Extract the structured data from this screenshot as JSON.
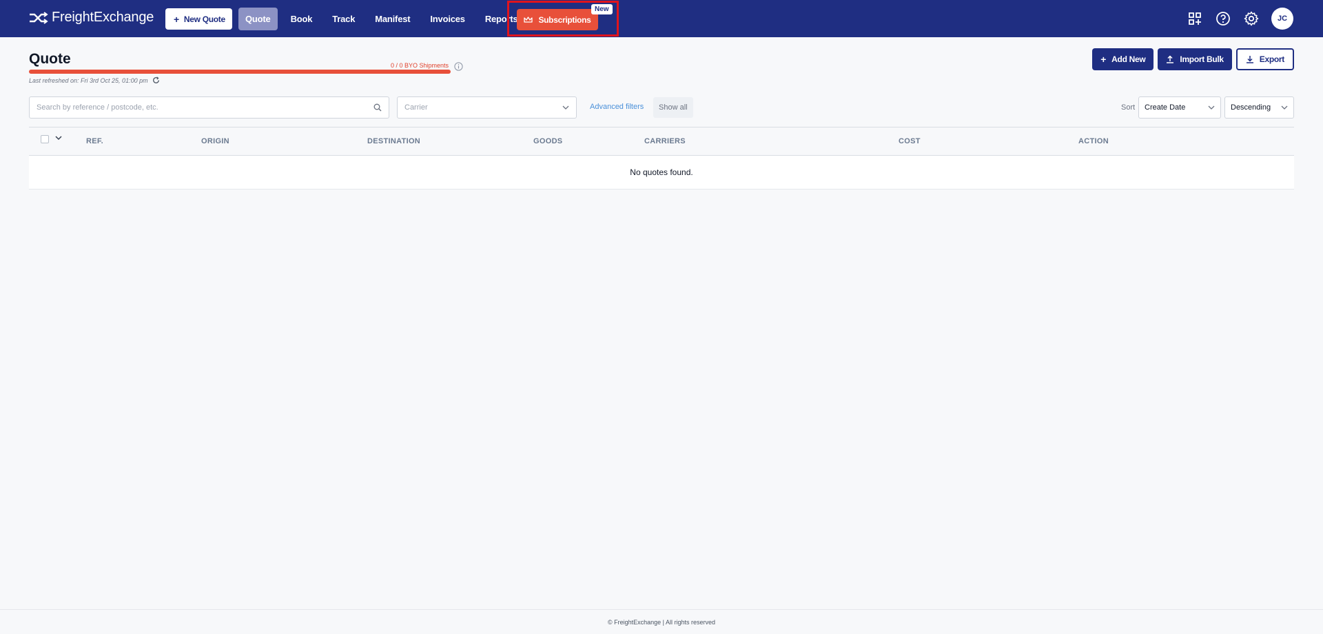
{
  "app": {
    "name": "FreightExchange"
  },
  "topbar": {
    "new_quote_label": "New Quote",
    "nav": [
      {
        "label": "Quote",
        "active": true
      },
      {
        "label": "Book",
        "active": false
      },
      {
        "label": "Track",
        "active": false
      },
      {
        "label": "Manifest",
        "active": false
      },
      {
        "label": "Invoices",
        "active": false
      },
      {
        "label": "Reports",
        "active": false
      }
    ],
    "subscriptions_label": "Subscriptions",
    "new_badge": "New",
    "icons": [
      "apps-add-icon",
      "help-icon",
      "settings-gear-icon"
    ],
    "avatar_initials": "JC"
  },
  "page": {
    "title": "Quote",
    "byo_label": "0 / 0 BYO Shipments",
    "byo_progress": 0,
    "last_refreshed": "Last refreshed on: Fri 3rd Oct 25, 01:00 pm",
    "buttons": {
      "add_new": "Add New",
      "import_bulk": "Import Bulk",
      "export": "Export"
    }
  },
  "filters": {
    "search_placeholder": "Search by reference / postcode, etc.",
    "carrier_placeholder": "Carrier",
    "advanced_filters": "Advanced filters",
    "show_all": "Show all",
    "sort_label": "Sort",
    "sort_field": "Create Date",
    "sort_order": "Descending"
  },
  "table": {
    "columns": [
      "REF.",
      "ORIGIN",
      "DESTINATION",
      "GOODS",
      "CARRIERS",
      "COST",
      "ACTION"
    ],
    "empty_message": "No quotes found."
  },
  "footer": {
    "text": "© FreightExchange | All rights reserved"
  },
  "colors": {
    "brand": "#1f2e82",
    "accent": "#e8503a",
    "highlight_frame": "#e0141d"
  }
}
